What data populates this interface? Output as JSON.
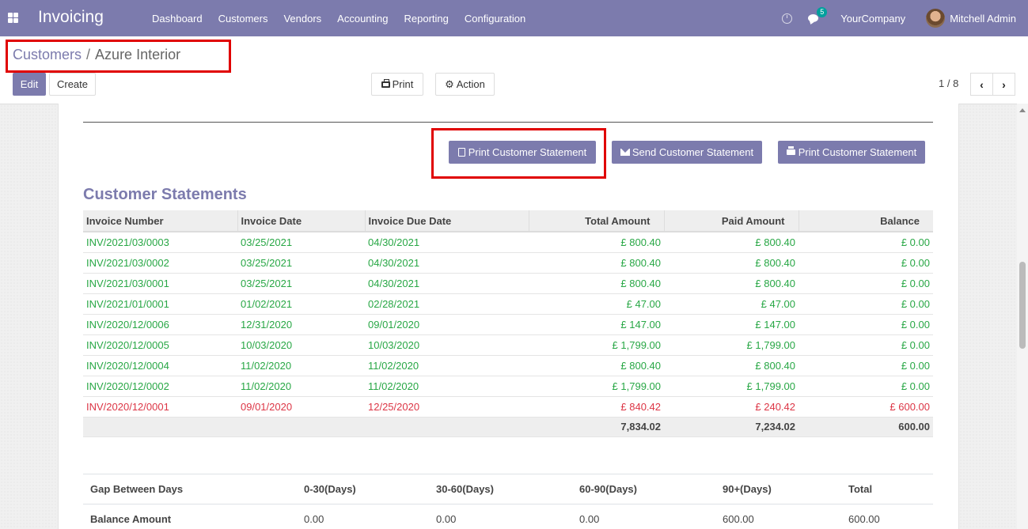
{
  "navbar": {
    "app_title": "Invoicing",
    "menu": [
      "Dashboard",
      "Customers",
      "Vendors",
      "Accounting",
      "Reporting",
      "Configuration"
    ],
    "message_count": "5",
    "company": "YourCompany",
    "user": "Mitchell Admin",
    "color": "#7c7bad"
  },
  "breadcrumb": {
    "parent": "Customers",
    "separator": "/",
    "current": "Azure Interior"
  },
  "toolbar": {
    "edit_label": "Edit",
    "create_label": "Create",
    "print_label": "Print",
    "action_label": "Action",
    "pager": "1 / 8"
  },
  "statement_buttons": {
    "print_xlsx": "Print Customer Statement",
    "send": "Send Customer Statement",
    "print_pdf": "Print Customer Statement"
  },
  "statements": {
    "title": "Customer Statements",
    "columns": [
      "Invoice Number",
      "Invoice Date",
      "Invoice Due Date",
      "Total Amount",
      "Paid Amount",
      "Balance"
    ],
    "rows": [
      {
        "number": "INV/2021/03/0003",
        "date": "03/25/2021",
        "due": "04/30/2021",
        "total": "£ 800.40",
        "paid": "£ 800.40",
        "balance": "£ 0.00",
        "status": "paid"
      },
      {
        "number": "INV/2021/03/0002",
        "date": "03/25/2021",
        "due": "04/30/2021",
        "total": "£ 800.40",
        "paid": "£ 800.40",
        "balance": "£ 0.00",
        "status": "paid"
      },
      {
        "number": "INV/2021/03/0001",
        "date": "03/25/2021",
        "due": "04/30/2021",
        "total": "£ 800.40",
        "paid": "£ 800.40",
        "balance": "£ 0.00",
        "status": "paid"
      },
      {
        "number": "INV/2021/01/0001",
        "date": "01/02/2021",
        "due": "02/28/2021",
        "total": "£ 47.00",
        "paid": "£ 47.00",
        "balance": "£ 0.00",
        "status": "paid"
      },
      {
        "number": "INV/2020/12/0006",
        "date": "12/31/2020",
        "due": "09/01/2020",
        "total": "£ 147.00",
        "paid": "£ 147.00",
        "balance": "£ 0.00",
        "status": "paid"
      },
      {
        "number": "INV/2020/12/0005",
        "date": "10/03/2020",
        "due": "10/03/2020",
        "total": "£ 1,799.00",
        "paid": "£ 1,799.00",
        "balance": "£ 0.00",
        "status": "paid"
      },
      {
        "number": "INV/2020/12/0004",
        "date": "11/02/2020",
        "due": "11/02/2020",
        "total": "£ 800.40",
        "paid": "£ 800.40",
        "balance": "£ 0.00",
        "status": "paid"
      },
      {
        "number": "INV/2020/12/0002",
        "date": "11/02/2020",
        "due": "11/02/2020",
        "total": "£ 1,799.00",
        "paid": "£ 1,799.00",
        "balance": "£ 0.00",
        "status": "paid"
      },
      {
        "number": "INV/2020/12/0001",
        "date": "09/01/2020",
        "due": "12/25/2020",
        "total": "£ 840.42",
        "paid": "£ 240.42",
        "balance": "£ 600.00",
        "status": "due"
      }
    ],
    "totals": {
      "total": "7,834.02",
      "paid": "7,234.02",
      "balance": "600.00"
    },
    "paid_color": "#28a745",
    "due_color": "#dc3545"
  },
  "aging": {
    "headers": [
      "Gap Between Days",
      "0-30(Days)",
      "30-60(Days)",
      "60-90(Days)",
      "90+(Days)",
      "Total"
    ],
    "row_label": "Balance Amount",
    "values": [
      "0.00",
      "0.00",
      "0.00",
      "600.00",
      "600.00"
    ]
  }
}
